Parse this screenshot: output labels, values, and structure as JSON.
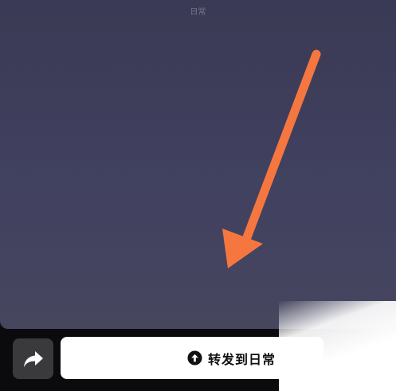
{
  "header": {
    "caption": "日常"
  },
  "annotation": {
    "arrow_color": "#f5773f",
    "arrow_icon": "pointer-arrow-icon"
  },
  "bottom_bar": {
    "share_icon": "share-forward-icon",
    "forward_button": {
      "icon": "arrow-up-circle-icon",
      "label": "转发到日常"
    }
  },
  "colors": {
    "background_top": "#3a3a55",
    "background_bottom": "#46465f",
    "bar_background": "#0b0b0d",
    "share_button_bg": "#3a3a3c",
    "forward_button_bg": "#ffffff"
  }
}
